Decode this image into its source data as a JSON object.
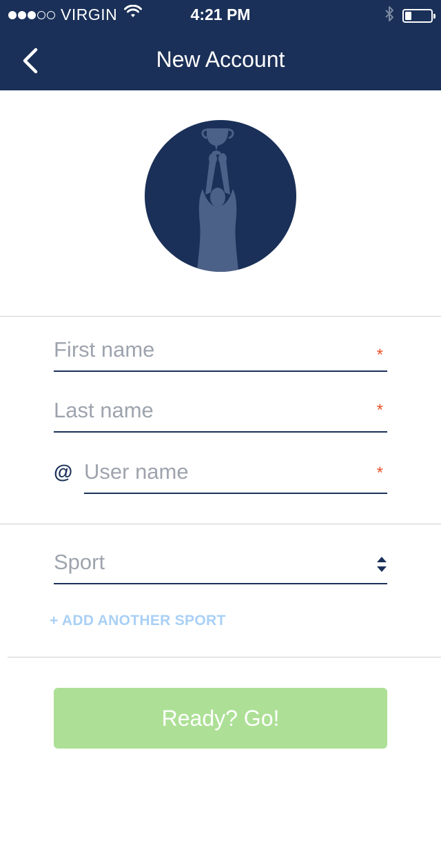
{
  "status_bar": {
    "carrier": "VIRGIN",
    "time": "4:21 PM",
    "signal_icon": "signal-dots-icon",
    "wifi_icon": "wifi-icon",
    "bluetooth_icon": "bluetooth-icon",
    "battery_icon": "battery-icon",
    "battery_level": 0.25
  },
  "nav": {
    "title": "New Account",
    "back_icon": "chevron-left-icon"
  },
  "profile": {
    "avatar_icon": "trophy-athlete-silhouette-icon"
  },
  "form": {
    "first_name": {
      "placeholder": "First name",
      "required_mark": "*"
    },
    "last_name": {
      "placeholder": "Last name",
      "required_mark": "*"
    },
    "user_name": {
      "prefix": "@",
      "placeholder": "User name",
      "required_mark": "*"
    },
    "sport": {
      "placeholder": "Sport",
      "stepper_icon": "up-down-stepper-icon"
    },
    "add_sport_label": "+ ADD ANOTHER SPORT",
    "submit_label": "Ready? Go!"
  },
  "colors": {
    "primary": "#1a3058",
    "required": "#e8542a",
    "link": "#a9d0f5",
    "button": "#ade096",
    "placeholder": "#9ea4ae"
  }
}
